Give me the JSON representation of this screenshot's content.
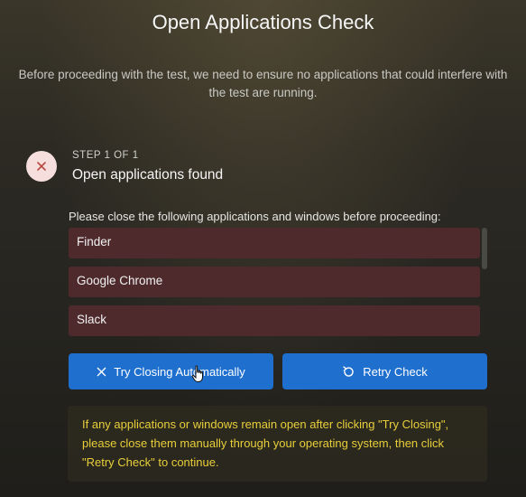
{
  "title": "Open Applications Check",
  "subtitle": "Before proceeding with the test, we need to ensure no applications that could interfere with the test are running.",
  "step": {
    "label": "STEP 1 OF 1",
    "title": "Open applications found",
    "icon": "close-icon",
    "icon_bg": "#f6dedd",
    "icon_color": "#c0392b"
  },
  "instruction": "Please close the following applications and windows before proceeding:",
  "applications": [
    "Finder",
    "Google Chrome",
    "Slack"
  ],
  "buttons": {
    "try_closing": "Try Closing Automatically",
    "retry_check": "Retry Check",
    "color": "#1f6fcf"
  },
  "notice": "If any applications or windows remain open after clicking \"Try Closing\", please close them manually through your operating system, then click \"Retry Check\" to continue.",
  "colors": {
    "app_item_bg": "#4e2a2c",
    "notice_text": "#e8cf3a"
  }
}
